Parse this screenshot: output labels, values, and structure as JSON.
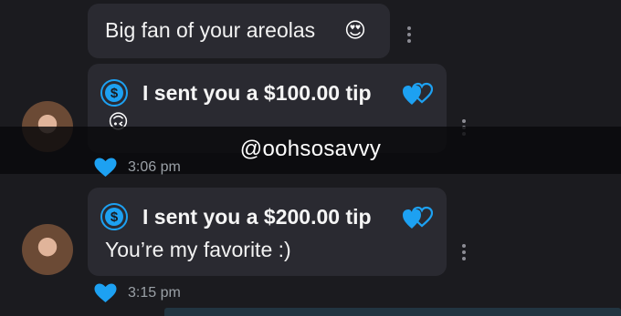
{
  "messages": [
    {
      "text": "Big fan of your areolas",
      "emoji": "😍"
    },
    {
      "tip_label": "I sent you a $100.00 tip",
      "text": "🙃",
      "time": "3:06 pm"
    },
    {
      "tip_label": "I sent you a $200.00 tip",
      "text": "You’re my favorite :)",
      "time": "3:15 pm"
    }
  ],
  "icons": {
    "dollar": "$",
    "tip": "dollar-circle-icon",
    "like": "heart-icon",
    "tip_hearts": "double-heart-icon",
    "more": "kebab-menu-icon"
  },
  "watermark": "@oohsosavvy",
  "colors": {
    "background": "#1b1b1f",
    "bubble": "#2a2a31",
    "accent": "#1da1f2"
  }
}
